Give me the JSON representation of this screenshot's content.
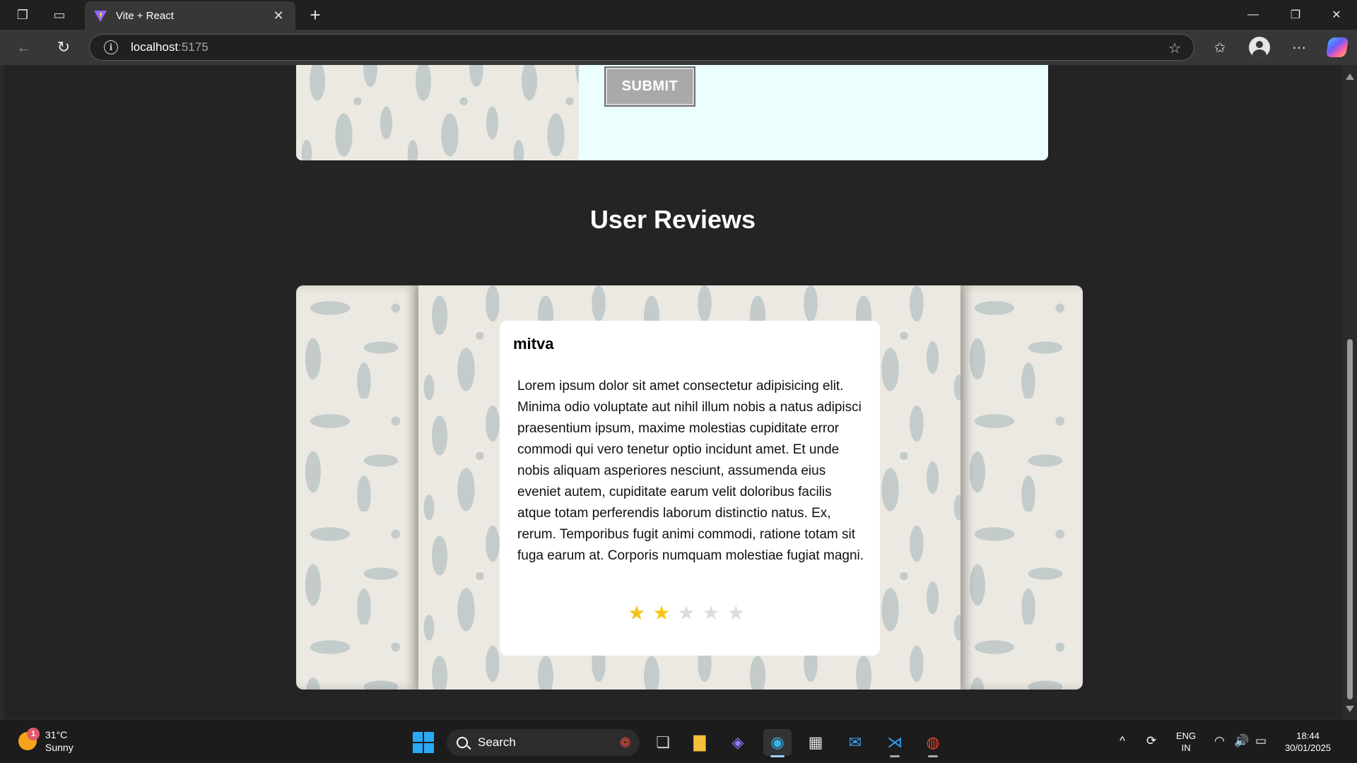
{
  "browser": {
    "tab_title": "Vite + React",
    "url_host": "localhost",
    "url_port": ":5175"
  },
  "page": {
    "submit_label": "SUBMIT",
    "section_title": "User Reviews",
    "review": {
      "author": "mitva",
      "text": "Lorem ipsum dolor sit amet consectetur adipisicing elit. Minima odio voluptate aut nihil illum nobis a natus adipisci praesentium ipsum, maxime molestias cupiditate error commodi qui vero tenetur optio incidunt amet. Et unde nobis aliquam asperiores nesciunt, assumenda eius eveniet autem, cupiditate earum velit doloribus facilis atque totam perferendis laborum distinctio natus. Ex, rerum. Temporibus fugit animi commodi, ratione totam sit fuga earum at. Corporis numquam molestiae fugiat magni.",
      "rating": 2,
      "rating_max": 5
    }
  },
  "taskbar": {
    "weather_temp": "31°C",
    "weather_desc": "Sunny",
    "weather_badge": "1",
    "search_label": "Search",
    "lang_top": "ENG",
    "lang_bottom": "IN",
    "time": "18:44",
    "date": "30/01/2025"
  },
  "colors": {
    "star_filled": "#f5c518",
    "star_empty": "#dcdcdc",
    "form_bg": "#ebffff"
  }
}
